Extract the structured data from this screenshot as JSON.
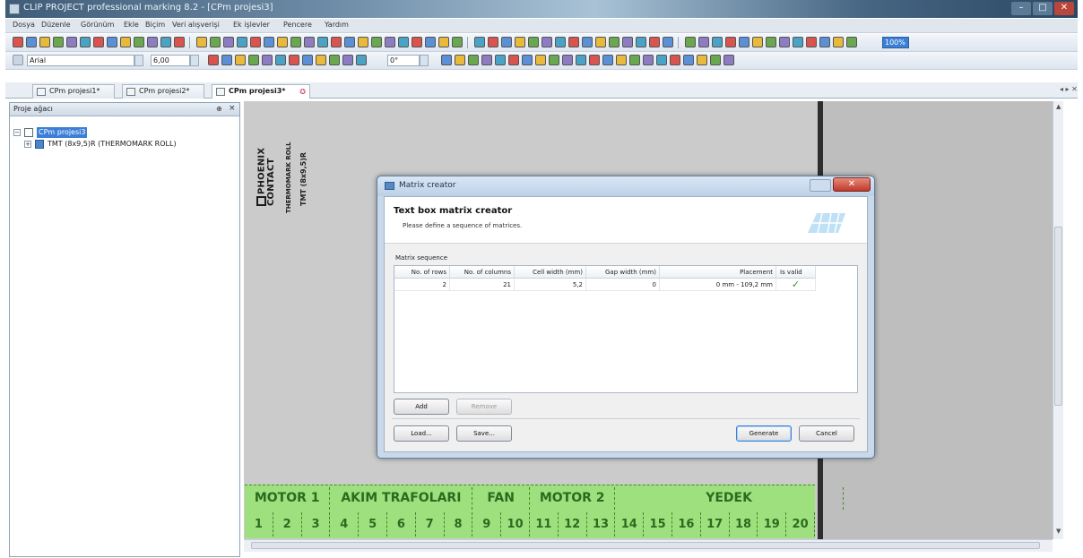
{
  "window": {
    "title": "CLIP PROJECT professional marking 8.2 - [CPm projesi3]"
  },
  "menu": [
    "Dosya",
    "Düzenle",
    "Görünüm",
    "Ekle",
    "Biçim",
    "Veri alışverişi",
    "Ek işlevler",
    "Pencere",
    "Yardım"
  ],
  "format_toolbar": {
    "font_name": "Arial",
    "font_size": "6,00",
    "rotation": "0°",
    "zoom": "100%"
  },
  "tabs": [
    {
      "label": "CPm projesi1*"
    },
    {
      "label": "CPm projesi2*"
    },
    {
      "label": "CPm projesi3*"
    }
  ],
  "tabbar_controls": "◂ ▸ ✕",
  "tree": {
    "title": "Proje ağacı",
    "pin": "📌",
    "close": "×",
    "root": "CPm projesi3",
    "child": "TMT (8x9,5)R (THERMOMARK ROLL)"
  },
  "canvas": {
    "brand": "PHOENIX CONTACT",
    "roll_label": "THERMOMARK ROLL",
    "tmt_label": "TMT (8x9,5)R"
  },
  "strip": {
    "groups": [
      {
        "label": "MOTOR 1",
        "span": 3
      },
      {
        "label": "AKIM TRAFOLARI",
        "span": 5
      },
      {
        "label": "FAN",
        "span": 2
      },
      {
        "label": "MOTOR 2",
        "span": 3
      },
      {
        "label": "YEDEK",
        "span": 8
      }
    ],
    "numbers": [
      "1",
      "2",
      "3",
      "4",
      "5",
      "6",
      "7",
      "8",
      "9",
      "10",
      "11",
      "12",
      "13",
      "14",
      "15",
      "16",
      "17",
      "18",
      "19",
      "20"
    ]
  },
  "dialog": {
    "title": "Matrix creator",
    "close": "✕",
    "heading": "Text box matrix creator",
    "subheading": "Please define a sequence of matrices.",
    "sequence_label": "Matrix sequence",
    "columns": [
      "No. of rows",
      "No. of columns",
      "Cell width (mm)",
      "Gap width (mm)",
      "Placement",
      "Is valid"
    ],
    "rows": [
      {
        "rows": "2",
        "columns": "21",
        "cell_width": "5,2",
        "gap_width": "0",
        "placement": "0 mm - 109,2 mm",
        "valid": "✓"
      }
    ],
    "buttons": {
      "add": "Add",
      "remove": "Remove",
      "load": "Load...",
      "save": "Save...",
      "generate": "Generate",
      "cancel": "Cancel"
    }
  },
  "colors": {
    "strip_green": "#9ee07e",
    "strip_text": "#2c6a1e",
    "dialog_frame": "#c9d9ea",
    "close_red": "#c0392b"
  }
}
